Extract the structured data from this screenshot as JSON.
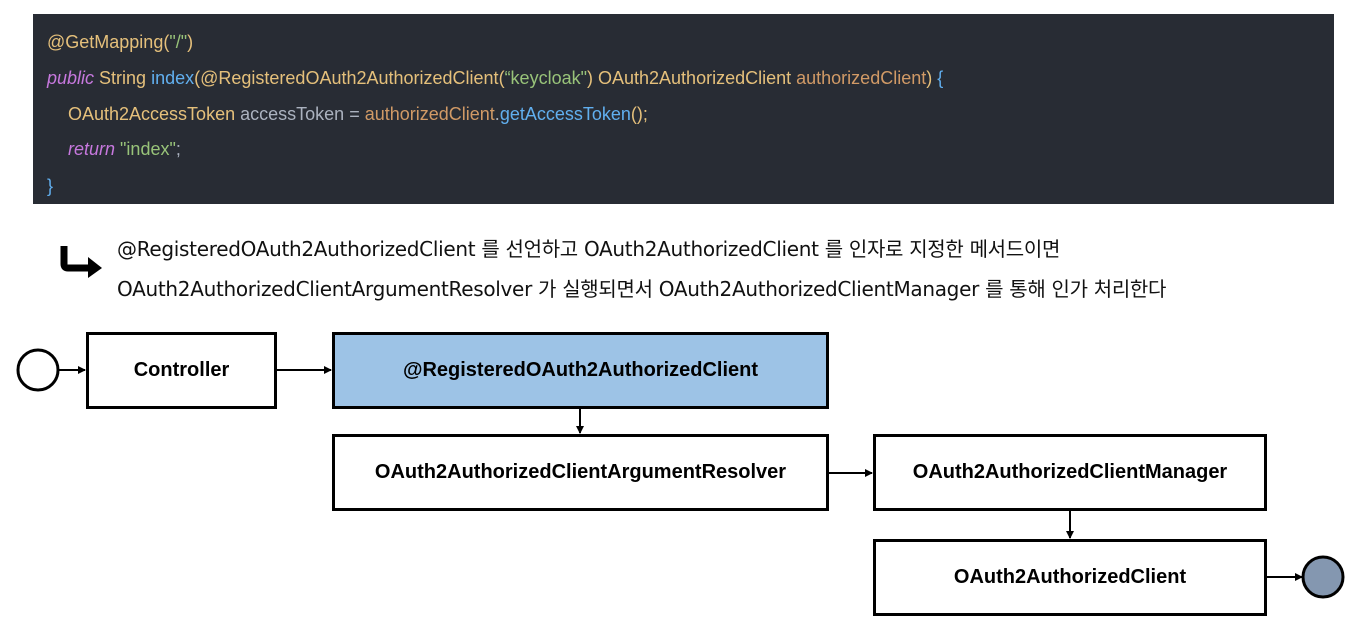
{
  "code": {
    "line1": {
      "annotation": "@GetMapping",
      "open": "(",
      "path": "\"/\"",
      "close": ")"
    },
    "line2": {
      "kw": "public",
      "type": "String",
      "method": "index",
      "open": "(",
      "annotation": "@RegisteredOAuth2AuthorizedClient",
      "aopen": "(",
      "arg": "“keycloak\"",
      "aclose": ")",
      "paramType": "OAuth2AuthorizedClient",
      "paramName": "authorizedClient",
      "close": ")",
      "brace": "{"
    },
    "line3": {
      "type": "OAuth2AccessToken",
      "var": "accessToken",
      "eq": "=",
      "obj": "authorizedClient",
      "dot": ".",
      "call": "getAccessToken",
      "parens": "();"
    },
    "line4": {
      "kw": "return",
      "value": "\"index\"",
      "semi": ";"
    },
    "line5": {
      "brace": "}"
    }
  },
  "description": {
    "line1": "@RegisteredOAuth2AuthorizedClient 를 선언하고 OAuth2AuthorizedClient 를 인자로 지정한 메서드이면",
    "line2": "OAuth2AuthorizedClientArgumentResolver 가 실행되면서 OAuth2AuthorizedClientManager 를 통해 인가 처리한다"
  },
  "diagram": {
    "controller": "Controller",
    "registered": "@RegisteredOAuth2AuthorizedClient",
    "resolver": "OAuth2AuthorizedClientArgumentResolver",
    "manager": "OAuth2AuthorizedClientManager",
    "client": "OAuth2AuthorizedClient",
    "colors": {
      "highlight": "#9dc3e6",
      "endNode": "#8497b0"
    }
  }
}
